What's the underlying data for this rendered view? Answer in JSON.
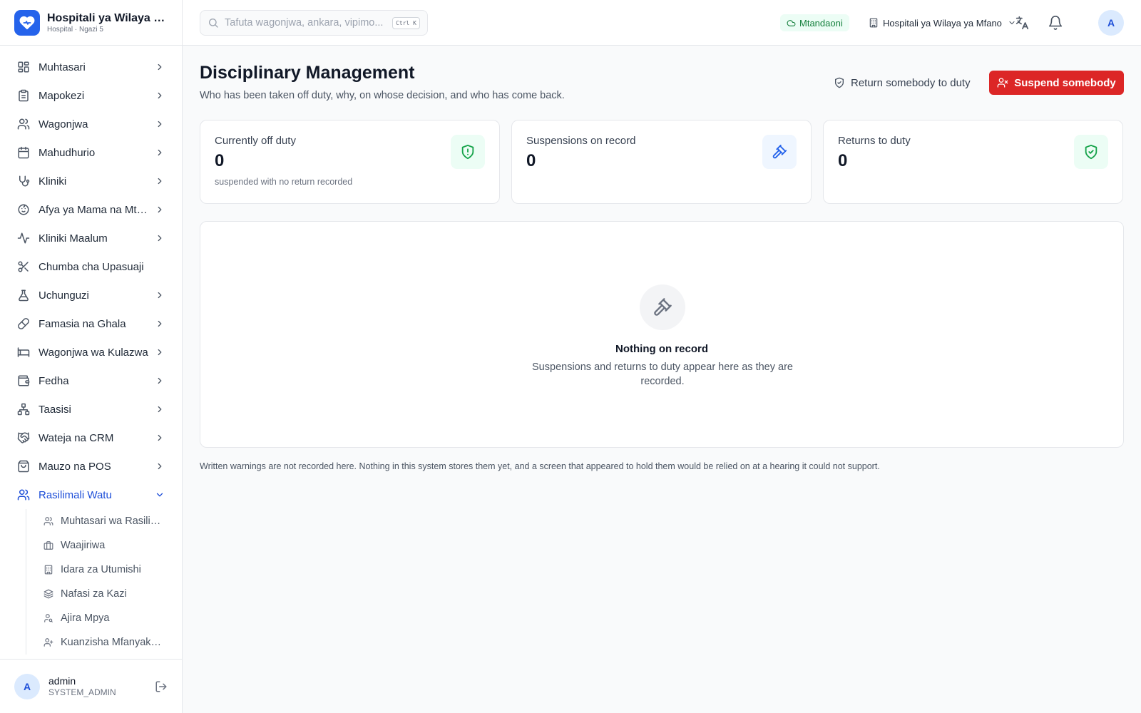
{
  "brand": {
    "name": "Hospitali ya Wilaya ya Mfano",
    "subtitle": "Hospital · Ngazi 5"
  },
  "sidebar": {
    "items": [
      {
        "label": "Muhtasari",
        "icon": "dashboard-icon",
        "has_chevron": true
      },
      {
        "label": "Mapokezi",
        "icon": "clipboard-icon",
        "has_chevron": true
      },
      {
        "label": "Wagonjwa",
        "icon": "users-icon",
        "has_chevron": true
      },
      {
        "label": "Mahudhurio",
        "icon": "calendar-icon",
        "has_chevron": true
      },
      {
        "label": "Kliniki",
        "icon": "stethoscope-icon",
        "has_chevron": true
      },
      {
        "label": "Afya ya Mama na Mtoto",
        "icon": "baby-icon",
        "has_chevron": true
      },
      {
        "label": "Kliniki Maalum",
        "icon": "activity-icon",
        "has_chevron": true
      },
      {
        "label": "Chumba cha Upasuaji",
        "icon": "scissors-icon",
        "has_chevron": false
      },
      {
        "label": "Uchunguzi",
        "icon": "flask-icon",
        "has_chevron": true
      },
      {
        "label": "Famasia na Ghala",
        "icon": "pill-icon",
        "has_chevron": true
      },
      {
        "label": "Wagonjwa wa Kulazwa",
        "icon": "bed-icon",
        "has_chevron": true
      },
      {
        "label": "Fedha",
        "icon": "wallet-icon",
        "has_chevron": true
      },
      {
        "label": "Taasisi",
        "icon": "network-icon",
        "has_chevron": true
      },
      {
        "label": "Wateja na CRM",
        "icon": "handshake-icon",
        "has_chevron": true
      },
      {
        "label": "Mauzo na POS",
        "icon": "shopping-bag-icon",
        "has_chevron": true
      },
      {
        "label": "Rasilimali Watu",
        "icon": "users-icon",
        "has_chevron": true,
        "active": true
      }
    ],
    "sub_items": [
      {
        "label": "Muhtasari wa Rasilimali Watu",
        "icon": "users-icon"
      },
      {
        "label": "Waajiriwa",
        "icon": "briefcase-icon"
      },
      {
        "label": "Idara za Utumishi",
        "icon": "building-icon"
      },
      {
        "label": "Nafasi za Kazi",
        "icon": "layers-icon"
      },
      {
        "label": "Ajira Mpya",
        "icon": "user-search-icon"
      },
      {
        "label": "Kuanzisha Mfanyakazi",
        "icon": "user-plus-icon"
      }
    ]
  },
  "user": {
    "initial": "A",
    "name": "admin",
    "role": "SYSTEM_ADMIN"
  },
  "topbar": {
    "search_placeholder": "Tafuta wagonjwa, ankara, vipimo...",
    "shortcut": "Ctrl K",
    "status": "Mtandaoni",
    "facility": "Hospitali ya Wilaya ya Mfano",
    "avatar_initial": "A"
  },
  "page": {
    "title": "Disciplinary Management",
    "subtitle": "Who has been taken off duty, why, on whose decision, and who has come back.",
    "return_button": "Return somebody to duty",
    "suspend_button": "Suspend somebody"
  },
  "stats": [
    {
      "label": "Currently off duty",
      "value": "0",
      "note": "suspended with no return recorded",
      "icon": "shield-alert-icon",
      "color": "#16a34a"
    },
    {
      "label": "Suspensions on record",
      "value": "0",
      "note": "",
      "icon": "gavel-icon",
      "color": "#2563eb"
    },
    {
      "label": "Returns to duty",
      "value": "0",
      "note": "",
      "icon": "shield-check-icon",
      "color": "#16a34a"
    }
  ],
  "empty_state": {
    "title": "Nothing on record",
    "description": "Suspensions and returns to duty appear here as they are recorded."
  },
  "footnote": "Written warnings are not recorded here. Nothing in this system stores them yet, and a screen that appeared to hold them would be relied on at a hearing it could not support.",
  "colors": {
    "accent": "#2563eb",
    "danger": "#dc2626",
    "success": "#16a34a"
  }
}
